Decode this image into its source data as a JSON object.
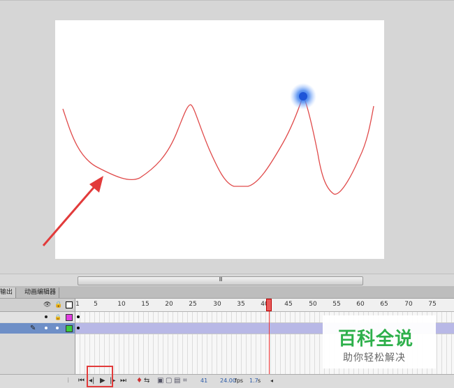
{
  "tabs": [
    {
      "label": "输出"
    },
    {
      "label": "动画编辑器"
    }
  ],
  "ruler": {
    "ticks": [
      "1",
      "5",
      "10",
      "15",
      "20",
      "25",
      "30",
      "35",
      "40",
      "45",
      "50",
      "55",
      "60",
      "65",
      "70",
      "75"
    ],
    "current_frame_marker": "41"
  },
  "layers": [
    {
      "name": "",
      "color": "#e040e0",
      "locked": true
    },
    {
      "name": "",
      "color": "#3ccc3c",
      "active": true
    }
  ],
  "controls": {
    "current_frame": "41",
    "fps": "24.00",
    "fps_unit": "fps",
    "time": "1.7",
    "time_unit": "s"
  },
  "scrollbar": {
    "grip": "III"
  },
  "watermark": {
    "title": "百科全说",
    "subtitle": "助你轻松解决"
  },
  "colors": {
    "stage_background": "#ffffff",
    "path_stroke": "#e04a4a",
    "ball": "#3a78e6",
    "annotation": "#e23b3b",
    "playhead": "#e33333"
  }
}
